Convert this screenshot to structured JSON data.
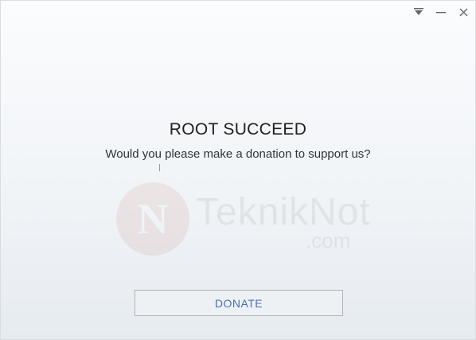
{
  "window": {
    "controls": [
      {
        "icon": "dropdown-icon"
      },
      {
        "icon": "minimize-icon"
      },
      {
        "icon": "close-icon"
      }
    ]
  },
  "dialog": {
    "title": "ROOT SUCCEED",
    "message": "Would you please make a donation to support us?",
    "donate_label": "DONATE"
  },
  "watermark": {
    "logo_letter": "N",
    "brand": "TeknikNot",
    "suffix": ".com"
  },
  "colors": {
    "button_text": "#4a6fb8",
    "watermark_red": "#b24a3a"
  }
}
